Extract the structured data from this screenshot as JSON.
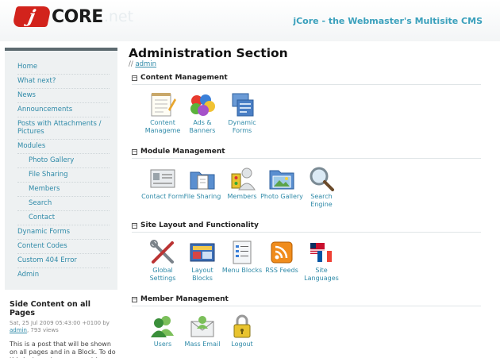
{
  "header": {
    "logo_j": "j",
    "logo_core": "CORE",
    "logo_net": ".net",
    "tagline": "jCore - the Webmaster's Multisite CMS"
  },
  "sidebar": {
    "items": [
      {
        "label": "Home"
      },
      {
        "label": "What next?"
      },
      {
        "label": "News"
      },
      {
        "label": "Announcements"
      },
      {
        "label": "Posts with Attachments / Pictures"
      },
      {
        "label": "Modules"
      },
      {
        "label": "Photo Gallery"
      },
      {
        "label": "File Sharing"
      },
      {
        "label": "Members"
      },
      {
        "label": "Search"
      },
      {
        "label": "Contact"
      },
      {
        "label": "Dynamic Forms"
      },
      {
        "label": "Content Codes"
      },
      {
        "label": "Custom 404 Error"
      },
      {
        "label": "Admin"
      }
    ]
  },
  "side_content": {
    "title": "Side Content on all Pages",
    "date": "Sat, 25 Jul 2009 05:43:00 +0100 by",
    "author": "admin",
    "views": ", 793 views",
    "text": "This is a post that will be shown on all pages and in a Block. To do this just create a new post in"
  },
  "main": {
    "title": "Administration Section",
    "crumb_prefix": "//",
    "crumb_link": "admin",
    "sections": [
      {
        "title": "Content Management",
        "items": [
          {
            "label": "Content Manageme",
            "icon": "content-management-icon"
          },
          {
            "label": "Ads & Banners",
            "icon": "ads-banners-icon"
          },
          {
            "label": "Dynamic Forms",
            "icon": "dynamic-forms-icon"
          }
        ]
      },
      {
        "title": "Module Management",
        "items": [
          {
            "label": "Contact Form",
            "icon": "contact-form-icon"
          },
          {
            "label": "File Sharing",
            "icon": "file-sharing-icon"
          },
          {
            "label": "Members",
            "icon": "members-icon"
          },
          {
            "label": "Photo Gallery",
            "icon": "photo-gallery-icon"
          },
          {
            "label": "Search Engine",
            "icon": "search-engine-icon"
          }
        ]
      },
      {
        "title": "Site Layout and Functionality",
        "items": [
          {
            "label": "Global Settings",
            "icon": "global-settings-icon"
          },
          {
            "label": "Layout Blocks",
            "icon": "layout-blocks-icon"
          },
          {
            "label": "Menu Blocks",
            "icon": "menu-blocks-icon"
          },
          {
            "label": "RSS Feeds",
            "icon": "rss-feeds-icon"
          },
          {
            "label": "Site Languages",
            "icon": "site-languages-icon"
          }
        ]
      },
      {
        "title": "Member Management",
        "items": [
          {
            "label": "Users",
            "icon": "users-icon"
          },
          {
            "label": "Mass Email",
            "icon": "mass-email-icon"
          },
          {
            "label": "Logout",
            "icon": "logout-icon"
          }
        ]
      }
    ]
  },
  "colors": {
    "link": "#2f8aa8",
    "tagline": "#3aa0bc",
    "logo_red": "#d2231c",
    "sidebar_bg": "#eef1f2"
  }
}
